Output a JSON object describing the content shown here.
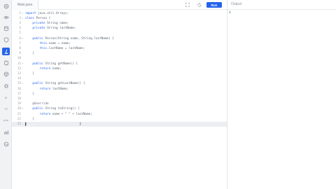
{
  "editor": {
    "file_tab": "Main.java",
    "run_label": "Run",
    "lines": [
      {
        "n": "1",
        "fold": "▾",
        "text": "import java.util.Arrays;",
        "kw": "import"
      },
      {
        "n": "2",
        "fold": "▾",
        "text": "class Person {",
        "kw": "class"
      },
      {
        "n": "3",
        "fold": "",
        "text": "    private String name;",
        "kw": "private"
      },
      {
        "n": "4",
        "fold": "",
        "text": "    private String lastName;",
        "kw": "private"
      },
      {
        "n": "5",
        "fold": "",
        "text": "",
        "kw": ""
      },
      {
        "n": "6",
        "fold": "▾",
        "text": "    public Person(String name, String lastName) {",
        "kw": "public"
      },
      {
        "n": "7",
        "fold": "",
        "text": "        this.name = name;",
        "kw": "this"
      },
      {
        "n": "8",
        "fold": "",
        "text": "        this.lastName = lastName;",
        "kw": "this"
      },
      {
        "n": "9",
        "fold": "",
        "text": "    }",
        "kw": ""
      },
      {
        "n": "10",
        "fold": "",
        "text": "",
        "kw": ""
      },
      {
        "n": "11",
        "fold": "▾",
        "text": "    public String getName() {",
        "kw": "public"
      },
      {
        "n": "12",
        "fold": "",
        "text": "        return name;",
        "kw": "return"
      },
      {
        "n": "13",
        "fold": "",
        "text": "    }",
        "kw": ""
      },
      {
        "n": "14",
        "fold": "",
        "text": "",
        "kw": ""
      },
      {
        "n": "15",
        "fold": "▾",
        "text": "    public String getLastName() {",
        "kw": "public"
      },
      {
        "n": "16",
        "fold": "",
        "text": "        return lastName;",
        "kw": "return"
      },
      {
        "n": "17",
        "fold": "",
        "text": "    }",
        "kw": ""
      },
      {
        "n": "18",
        "fold": "",
        "text": "",
        "kw": ""
      },
      {
        "n": "19",
        "fold": "",
        "text": "    @Override",
        "kw": ""
      },
      {
        "n": "20",
        "fold": "▾",
        "text": "    public String toString() {",
        "kw": "public"
      },
      {
        "n": "21",
        "fold": "",
        "text": "        return name + \" \" + lastName;",
        "kw": "return"
      },
      {
        "n": "22",
        "fold": "",
        "text": "    }",
        "kw": ""
      },
      {
        "n": "23",
        "fold": "",
        "text": "}",
        "kw": ""
      }
    ],
    "active_line": "23"
  },
  "output": {
    "label": "Output",
    "text": "$"
  },
  "sidebar": {
    "items": [
      {
        "name": "logo-icon"
      },
      {
        "name": "eye-icon"
      },
      {
        "name": "database-icon"
      },
      {
        "name": "shield-icon"
      },
      {
        "name": "java-icon",
        "active": true
      },
      {
        "name": "python-icon"
      },
      {
        "name": "cube-icon"
      },
      {
        "name": "gear-icon"
      },
      {
        "name": "js-label",
        "text": "JS"
      },
      {
        "name": "ts-label",
        "text": "TS"
      },
      {
        "name": "php-label",
        "text": "php"
      },
      {
        "name": "chart-icon"
      },
      {
        "name": "swift-icon"
      }
    ]
  },
  "colors": {
    "accent": "#2563eb"
  }
}
